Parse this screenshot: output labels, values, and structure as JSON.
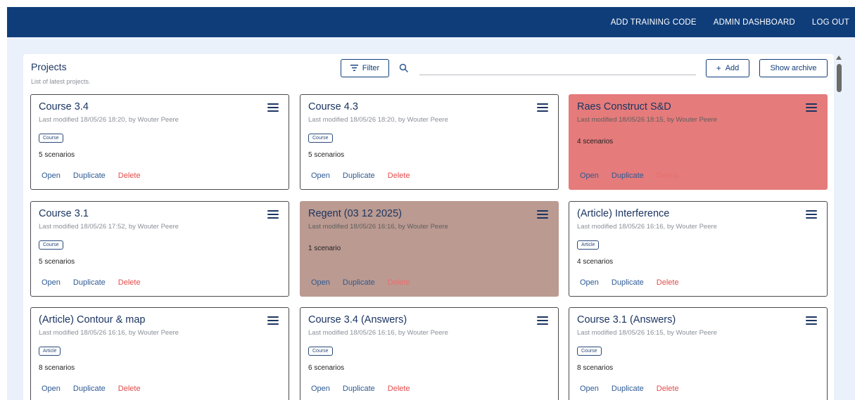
{
  "nav": {
    "items": [
      "ADD TRAINING CODE",
      "ADMIN DASHBOARD",
      "LOG OUT"
    ]
  },
  "header": {
    "title": "Projects",
    "subtitle": "List of latest projects."
  },
  "toolbar": {
    "filter_label": "Filter",
    "filter_icon": "filter-lines-icon",
    "search_icon": "search-icon",
    "search_placeholder": "",
    "search_value": "",
    "add_label": "Add",
    "add_icon": "plus-icon",
    "archive_label": "Show archive"
  },
  "colors": {
    "appbar": "#0f3d7a",
    "background": "#eaf1fb",
    "card_red": "#e57b7b",
    "card_brown": "#bb9a91",
    "delete": "#e34b4b",
    "accent": "#2d5a94"
  },
  "actions": {
    "open": "Open",
    "duplicate": "Duplicate",
    "delete": "Delete"
  },
  "projects": [
    {
      "title": "Course 3.4",
      "meta": "Last modified 18/05/26 18:20, by Wouter Peere",
      "tag": "Course",
      "scenarios": "5 scenarios",
      "highlight": "none"
    },
    {
      "title": "Course 4.3",
      "meta": "Last modified 18/05/26 18:20, by Wouter Peere",
      "tag": "Course",
      "scenarios": "5 scenarios",
      "highlight": "none"
    },
    {
      "title": "Raes Construct S&D",
      "meta": "Last modified 18/05/26 18:15, by Wouter Peere",
      "tag": "",
      "scenarios": "4 scenarios",
      "highlight": "red"
    },
    {
      "title": "Course 3.1",
      "meta": "Last modified 18/05/26 17:52, by Wouter Peere",
      "tag": "Course",
      "scenarios": "5 scenarios",
      "highlight": "none"
    },
    {
      "title": "Regent (03 12 2025)",
      "meta": "Last modified 18/05/26 16:16, by Wouter Peere",
      "tag": "",
      "scenarios": "1 scenario",
      "highlight": "brown"
    },
    {
      "title": "(Article) Interference",
      "meta": "Last modified 18/05/26 16:16, by Wouter Peere",
      "tag": "Article",
      "scenarios": "4 scenarios",
      "highlight": "none"
    },
    {
      "title": "(Article) Contour & map",
      "meta": "Last modified 18/05/26 16:16, by Wouter Peere",
      "tag": "Article",
      "scenarios": "8 scenarios",
      "highlight": "none"
    },
    {
      "title": "Course 3.4 (Answers)",
      "meta": "Last modified 18/05/26 16:16, by Wouter Peere",
      "tag": "Course",
      "scenarios": "6 scenarios",
      "highlight": "none"
    },
    {
      "title": "Course 3.1 (Answers)",
      "meta": "Last modified 18/05/26 16:15, by Wouter Peere",
      "tag": "Course",
      "scenarios": "8 scenarios",
      "highlight": "none"
    }
  ]
}
